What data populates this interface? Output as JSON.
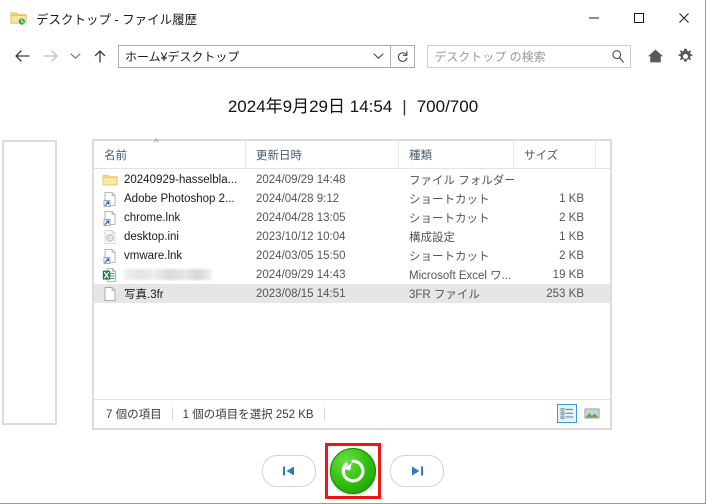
{
  "window": {
    "title": "デスクトップ - ファイル履歴",
    "icon": "file-history-folder-icon",
    "minimize_label": "最小化",
    "maximize_label": "最大化",
    "close_label": "閉じる"
  },
  "toolbar": {
    "back_label": "戻る",
    "forward_label": "進む",
    "recent_label": "最近の場所",
    "up_label": "上へ",
    "address_value": "ホーム¥デスクトップ",
    "address_dropdown_label": "以前の場所",
    "refresh_label": "更新",
    "search_placeholder": "デスクトップ の検索",
    "search_value": "",
    "home_label": "ホーム",
    "settings_label": "設定"
  },
  "header": {
    "date": "2024年9月29日 14:54",
    "separator": "|",
    "counter": "700/700"
  },
  "filelist": {
    "columns": [
      {
        "label": "名前",
        "sort": "^"
      },
      {
        "label": "更新日時",
        "sort": ""
      },
      {
        "label": "種類",
        "sort": ""
      },
      {
        "label": "サイズ",
        "sort": ""
      }
    ],
    "rows": [
      {
        "name": "20240929-hasselbla...",
        "date": "2024/09/29 14:48",
        "type": "ファイル フォルダー",
        "size": "",
        "icon": "folder-icon",
        "selected": false,
        "redacted": false
      },
      {
        "name": "Adobe Photoshop 2...",
        "date": "2024/04/28 9:12",
        "type": "ショートカット",
        "size": "1 KB",
        "icon": "shortcut-icon",
        "selected": false,
        "redacted": false
      },
      {
        "name": "chrome.lnk",
        "date": "2024/04/28 13:05",
        "type": "ショートカット",
        "size": "2 KB",
        "icon": "shortcut-icon",
        "selected": false,
        "redacted": false
      },
      {
        "name": "desktop.ini",
        "date": "2023/10/12 10:04",
        "type": "構成設定",
        "size": "1 KB",
        "icon": "ini-config-icon",
        "selected": false,
        "redacted": false
      },
      {
        "name": "vmware.lnk",
        "date": "2024/03/05 15:50",
        "type": "ショートカット",
        "size": "2 KB",
        "icon": "shortcut-icon",
        "selected": false,
        "redacted": false
      },
      {
        "name": "",
        "date": "2024/09/29 14:43",
        "type": "Microsoft Excel ワ...",
        "size": "19 KB",
        "icon": "excel-icon",
        "selected": false,
        "redacted": true
      },
      {
        "name": "写真.3fr",
        "date": "2023/08/15 14:51",
        "type": "3FR ファイル",
        "size": "253 KB",
        "icon": "generic-file-icon",
        "selected": true,
        "redacted": false
      }
    ]
  },
  "statusbar": {
    "item_count": "7 個の項目",
    "selection": "1 個の項目を選択  252 KB",
    "details_view_label": "詳細表示",
    "large_icons_view_label": "大アイコン表示"
  },
  "bottomnav": {
    "prev_label": "前のバージョン",
    "restore_label": "元の場所に復元",
    "next_label": "次のバージョン",
    "highlight_color": "#f01414",
    "restore_color": "#2dbf0a"
  }
}
